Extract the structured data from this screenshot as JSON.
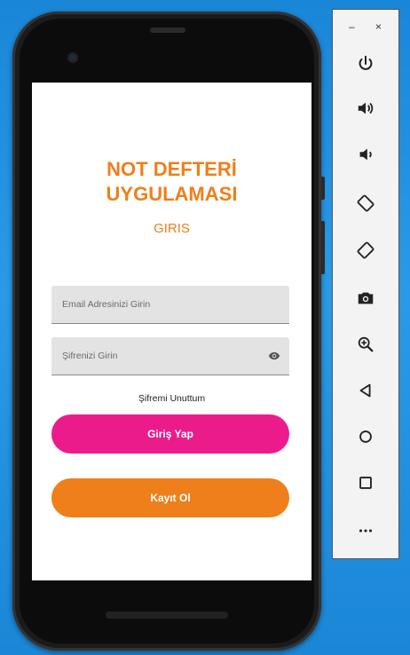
{
  "app": {
    "title_line1": "NOT DEFTERİ",
    "title_line2": "UYGULAMASI",
    "subtitle": "GIRIS"
  },
  "login_form": {
    "email_placeholder": "Email Adresinizi Girin",
    "password_placeholder": "Şifrenizi Girin",
    "forgot_password": "Şifremi Unuttum",
    "login_button": "Giriş Yap",
    "register_button": "Kayıt Ol"
  },
  "colors": {
    "accent_orange": "#ef7f1a",
    "accent_pink": "#ec1b8c",
    "desktop_background": "#1a86d8"
  },
  "emulator_toolbar": {
    "minimize": "–",
    "close": "×",
    "icons": [
      "power-icon",
      "volume-up-icon",
      "volume-down-icon",
      "rotate-left-icon",
      "rotate-right-icon",
      "camera-icon",
      "zoom-icon",
      "back-icon",
      "home-icon",
      "overview-icon",
      "more-icon"
    ]
  }
}
